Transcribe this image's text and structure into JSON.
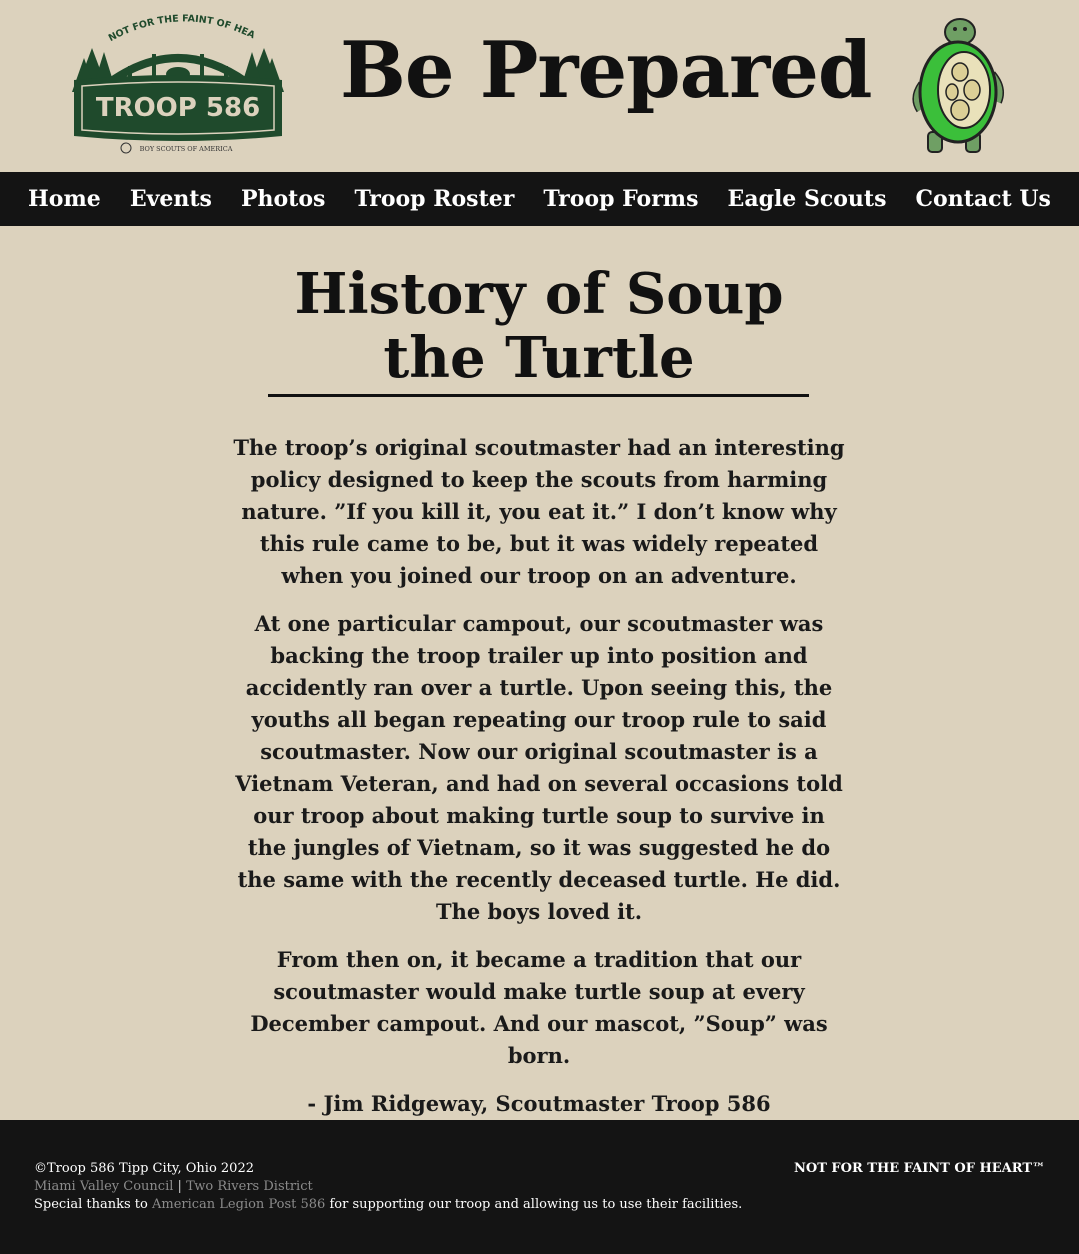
{
  "header": {
    "logo": {
      "arc_text": "NOT FOR THE FAINT OF HEART",
      "troop_label": "TROOP 586",
      "bsa_label": "BOY SCOUTS OF AMERICA",
      "icon": "troop-logo-icon"
    },
    "title": "Be Prepared",
    "mascot_icon": "turtle-mascot-icon"
  },
  "nav": {
    "items": [
      {
        "label": "Home"
      },
      {
        "label": "Events"
      },
      {
        "label": "Photos"
      },
      {
        "label": "Troop Roster"
      },
      {
        "label": "Troop Forms"
      },
      {
        "label": "Eagle Scouts"
      },
      {
        "label": "Contact Us"
      }
    ]
  },
  "main": {
    "title_line1": "History of Soup",
    "title_line2": "the Turtle",
    "paragraphs": [
      "The troop’s original scoutmaster had an interesting policy designed to keep the scouts from harming nature. ”If you kill it, you eat it.” I don’t know why this rule came to be, but it was widely repeated when you joined our troop on an adventure.",
      "At one particular campout, our scoutmaster was backing the troop trailer up into position and accidently ran over a turtle. Upon seeing this, the youths all began repeating our troop rule to said scoutmaster. Now our original scoutmaster is a Vietnam Veteran, and had on several occasions told our troop about making turtle soup to survive in the jungles of Vietnam, so it was suggested he do the same with the recently deceased turtle. He did. The boys loved it.",
      "From then on, it became a tradition that our scoutmaster would make turtle soup at every December campout. And our mascot, ”Soup” was born.",
      "- Jim Ridgeway, Scoutmaster Troop 586"
    ]
  },
  "footer": {
    "copyright": "©Troop 586 Tipp City, Ohio 2022",
    "council_link": "Miami Valley Council",
    "separator": "|",
    "district_link": "Two Rivers District",
    "thanks_prefix": "Special thanks to ",
    "post_link": "American Legion Post 586",
    "thanks_suffix": " for supporting our troop and allowing us to use their facilities.",
    "tagline": "NOT FOR THE FAINT OF HEART™"
  },
  "colors": {
    "background": "#dcd2bd",
    "nav_bg": "#141414",
    "logo_green": "#1f4a2c",
    "turtle_green": "#3bbf3a"
  }
}
